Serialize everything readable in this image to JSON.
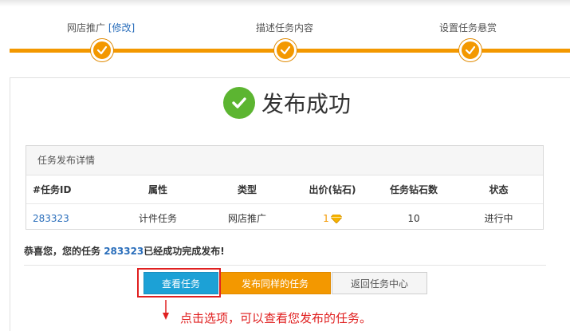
{
  "steps": [
    {
      "label": "网店推广",
      "link": "[修改]"
    },
    {
      "label": "描述任务内容"
    },
    {
      "label": "设置任务悬赏"
    }
  ],
  "success": {
    "title": "发布成功"
  },
  "details": {
    "header": "任务发布详情",
    "columns": [
      "#任务ID",
      "属性",
      "类型",
      "出价(钻石)",
      "任务钻石数",
      "状态"
    ],
    "row": {
      "id": "283323",
      "attribute": "计件任务",
      "type": "网店推广",
      "price": "1",
      "diamonds": "10",
      "status": "进行中"
    }
  },
  "congrats": {
    "prefix": "恭喜您，您的任务 ",
    "id": "283323",
    "suffix": "已经成功完成发布!"
  },
  "buttons": {
    "view": "查看任务",
    "same": "发布同样的任务",
    "back": "返回任务中心"
  },
  "annotation": "点击选项，可以查看您发布的任务。",
  "colors": {
    "accent": "#f39800",
    "primary": "#1ca1d6",
    "success": "#5cb531",
    "annotation": "#e02020"
  }
}
